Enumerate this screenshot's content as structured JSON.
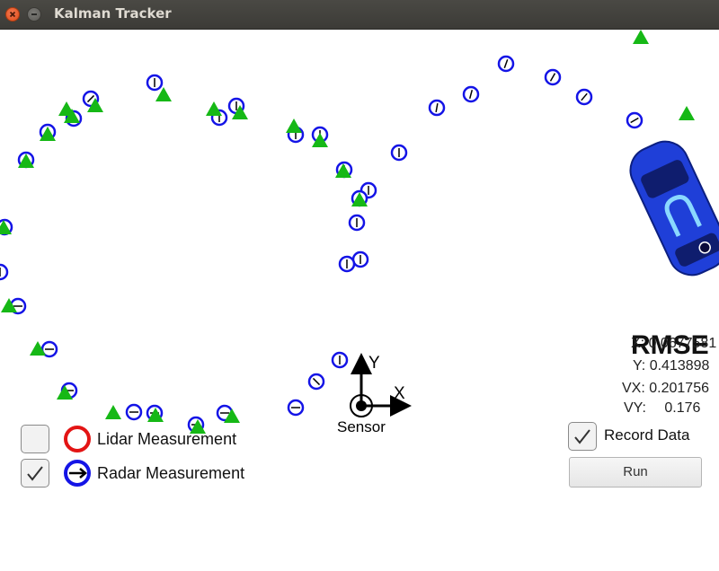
{
  "window": {
    "title": "Kalman Tracker"
  },
  "axes": {
    "y_label": "Y",
    "x_label": "X",
    "sensor_label": "Sensor"
  },
  "rmse": {
    "title": "RMSE",
    "x_label": "X:",
    "x_value": "0.0677581",
    "y_label": "Y:",
    "y_value": "0.413898",
    "vx_label": "VX:",
    "vx_value": "0.201756",
    "vy_label": "VY:",
    "vy_value": "0.176"
  },
  "legend": {
    "lidar_label": "Lidar Measurement",
    "lidar_checked": false,
    "radar_label": "Radar Measurement",
    "radar_checked": true
  },
  "controls": {
    "record_label": "Record Data",
    "record_checked": true,
    "run_label": "Run"
  },
  "colors": {
    "radar": "#1414e6",
    "lidar": "#e31414",
    "estimate": "#16b816",
    "car": "#1f3fd8"
  },
  "icons": [
    "close-icon",
    "minimize-icon",
    "checkmark-icon",
    "car-icon",
    "estimate-marker-icon",
    "radar-marker-icon"
  ]
}
